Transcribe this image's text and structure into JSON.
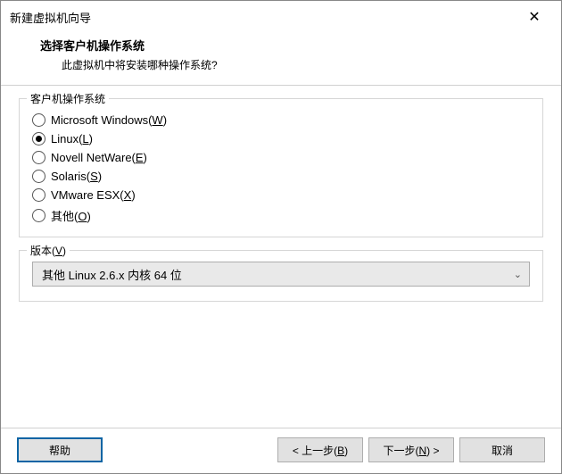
{
  "window": {
    "title": "新建虚拟机向导"
  },
  "header": {
    "title": "选择客户机操作系统",
    "subtitle": "此虚拟机中将安装哪种操作系统?"
  },
  "osGroup": {
    "label": "客户机操作系统",
    "options": [
      {
        "text": "Microsoft Windows(",
        "mnemonic": "W",
        "suffix": ")",
        "checked": false
      },
      {
        "text": "Linux(",
        "mnemonic": "L",
        "suffix": ")",
        "checked": true
      },
      {
        "text": "Novell NetWare(",
        "mnemonic": "E",
        "suffix": ")",
        "checked": false
      },
      {
        "text": "Solaris(",
        "mnemonic": "S",
        "suffix": ")",
        "checked": false
      },
      {
        "text": "VMware ESX(",
        "mnemonic": "X",
        "suffix": ")",
        "checked": false
      },
      {
        "text": "其他(",
        "mnemonic": "O",
        "suffix": ")",
        "checked": false
      }
    ]
  },
  "versionGroup": {
    "labelText": "版本(",
    "labelMnemonic": "V",
    "labelSuffix": ")",
    "selected": "其他 Linux 2.6.x 内核 64 位"
  },
  "buttons": {
    "help": "帮助",
    "backPre": "< 上一步(",
    "backMn": "B",
    "backSuf": ")",
    "nextPre": "下一步(",
    "nextMn": "N",
    "nextSuf": ") >",
    "cancel": "取消"
  }
}
